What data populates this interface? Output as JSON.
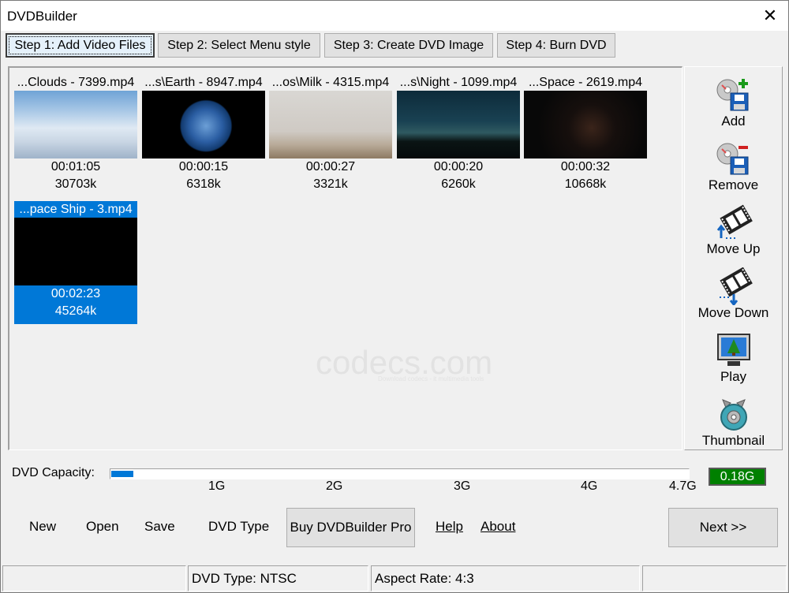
{
  "window": {
    "title": "DVDBuilder"
  },
  "tabs": [
    {
      "label": "Step 1: Add Video Files"
    },
    {
      "label": "Step 2: Select Menu style"
    },
    {
      "label": "Step 3: Create DVD Image"
    },
    {
      "label": "Step 4: Burn DVD"
    }
  ],
  "files": [
    {
      "name": "...Clouds - 7399.mp4",
      "duration": "00:01:05",
      "size": "30703k"
    },
    {
      "name": "...s\\Earth - 8947.mp4",
      "duration": "00:00:15",
      "size": "6318k"
    },
    {
      "name": "...os\\Milk - 4315.mp4",
      "duration": "00:00:27",
      "size": "3321k"
    },
    {
      "name": "...s\\Night - 1099.mp4",
      "duration": "00:00:20",
      "size": "6260k"
    },
    {
      "name": "...Space - 2619.mp4",
      "duration": "00:00:32",
      "size": "10668k"
    },
    {
      "name": "...pace Ship - 3.mp4",
      "duration": "00:02:23",
      "size": "45264k",
      "selected": true
    }
  ],
  "watermark": {
    "main": "codecs.com",
    "sub": "Download codecs - it multimedia tools"
  },
  "sidebar": [
    {
      "label": "Add",
      "icon": "add-disk-icon"
    },
    {
      "label": "Remove",
      "icon": "remove-disk-icon"
    },
    {
      "label": "Move Up",
      "icon": "film-move-up-icon"
    },
    {
      "label": "Move Down",
      "icon": "film-move-down-icon"
    },
    {
      "label": "Play",
      "icon": "play-monitor-icon"
    },
    {
      "label": "Thumbnail",
      "icon": "thumbnail-tool-icon"
    }
  ],
  "capacity": {
    "label": "DVD Capacity:",
    "value": "0.18G",
    "fraction": 0.038,
    "ticks": [
      "1G",
      "2G",
      "3G",
      "4G",
      "4.7G"
    ]
  },
  "toolbar": {
    "new": "New",
    "open": "Open",
    "save": "Save",
    "dvd_type": "DVD Type",
    "buy_pro": "Buy DVDBuilder Pro",
    "help": "Help",
    "about": "About",
    "next": "Next >>"
  },
  "status": {
    "dvd_type": "DVD Type: NTSC",
    "aspect": "Aspect Rate: 4:3"
  },
  "colors": {
    "selection": "#0078d7",
    "capacity_badge": "#008000"
  }
}
